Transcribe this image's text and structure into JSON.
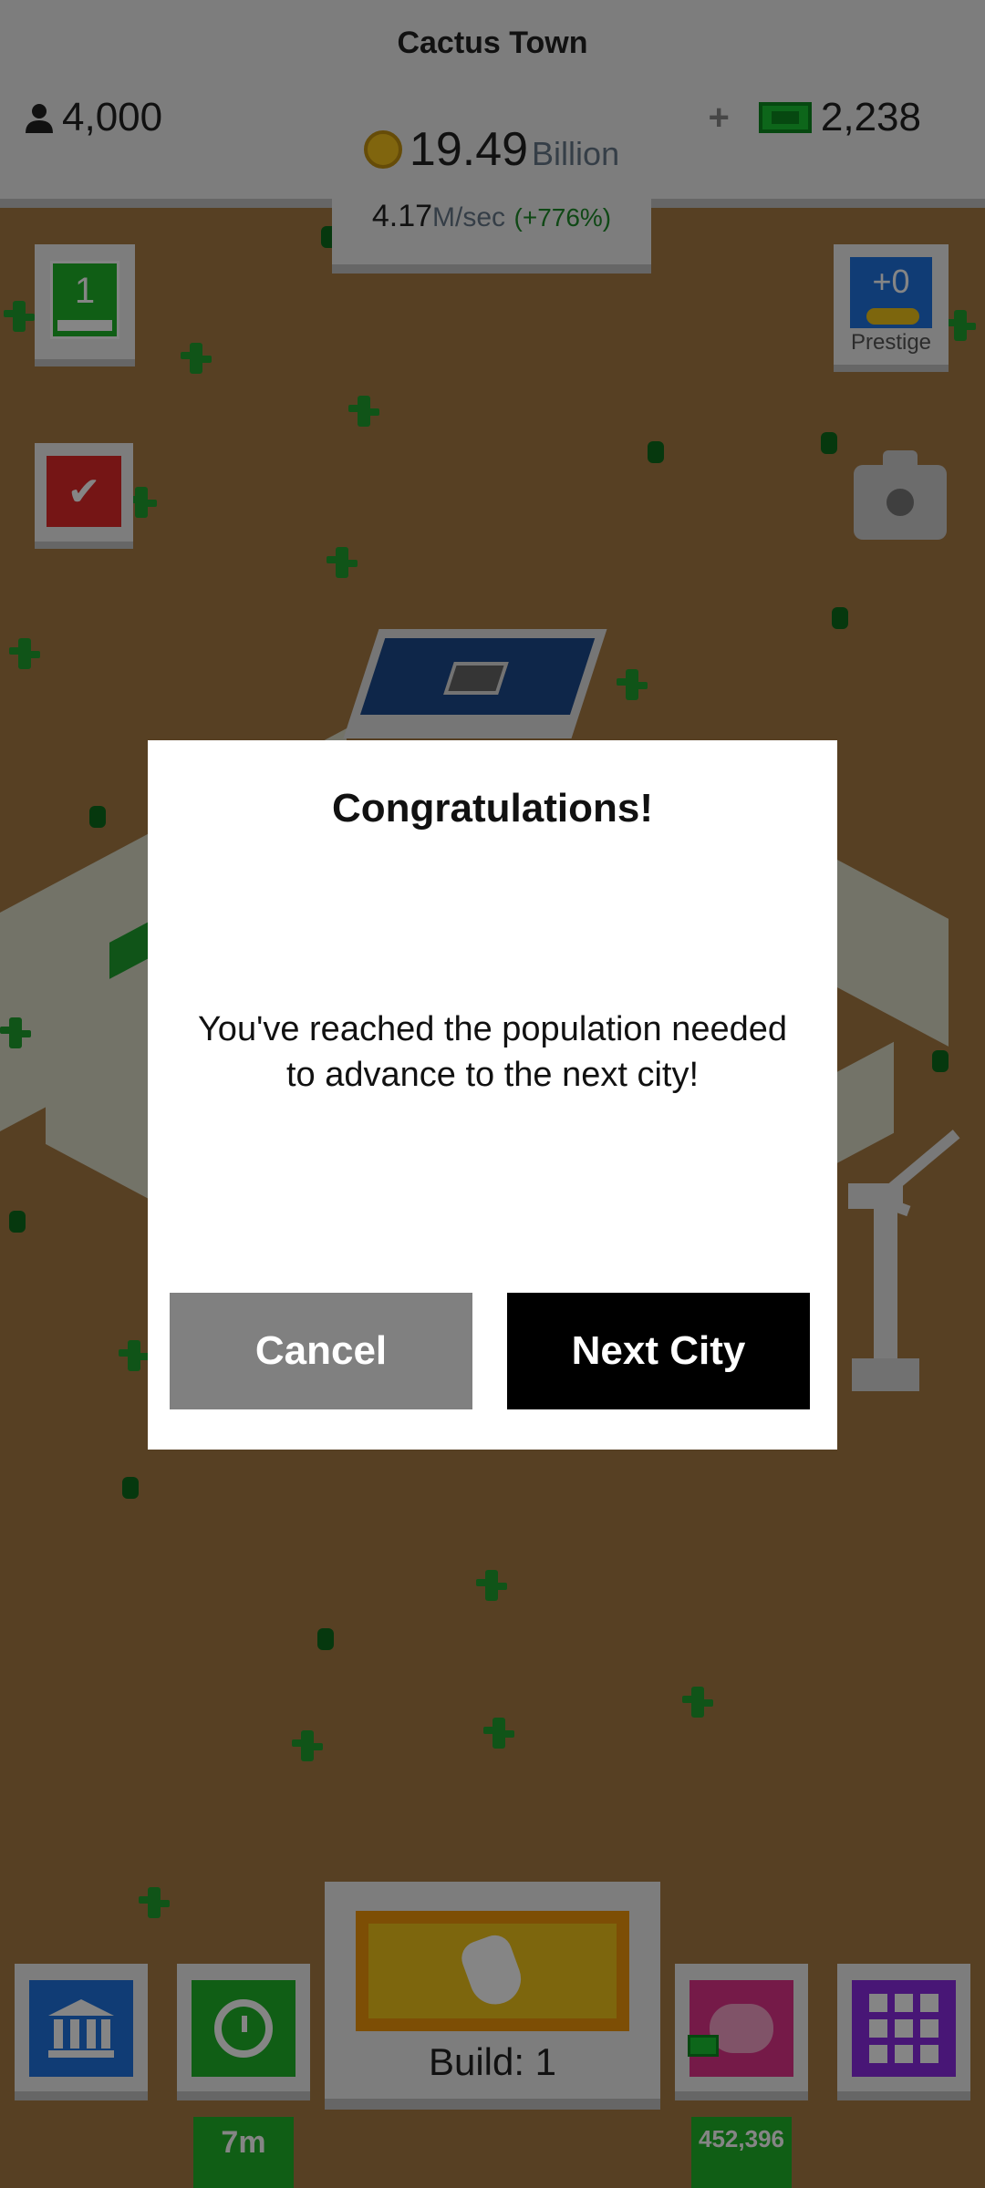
{
  "header": {
    "city_name": "Cactus Town",
    "population": "4,000",
    "cash_plus": "+",
    "cash": "2,238",
    "money_value": "19.49",
    "money_unit": "Billion",
    "rate_value": "4.17",
    "rate_unit": "M/sec",
    "rate_change": "(+776%)"
  },
  "side": {
    "level": "1",
    "prestige_count": "+0",
    "prestige_label": "Prestige"
  },
  "dialog": {
    "title": "Congratulations!",
    "message": "You've reached the population needed to advance to the next city!",
    "cancel_label": "Cancel",
    "next_label": "Next City"
  },
  "bottom": {
    "build_label": "Build: 1",
    "timer_tag": "7m",
    "savings_tag": "452,396"
  },
  "colors": {
    "accent_green": "#1fb52a",
    "bank_blue": "#1f74e0",
    "piggy_pink": "#e0338a",
    "grid_purple": "#8a2be2",
    "build_yellow": "#f0c419",
    "check_red": "#e02a2a"
  }
}
